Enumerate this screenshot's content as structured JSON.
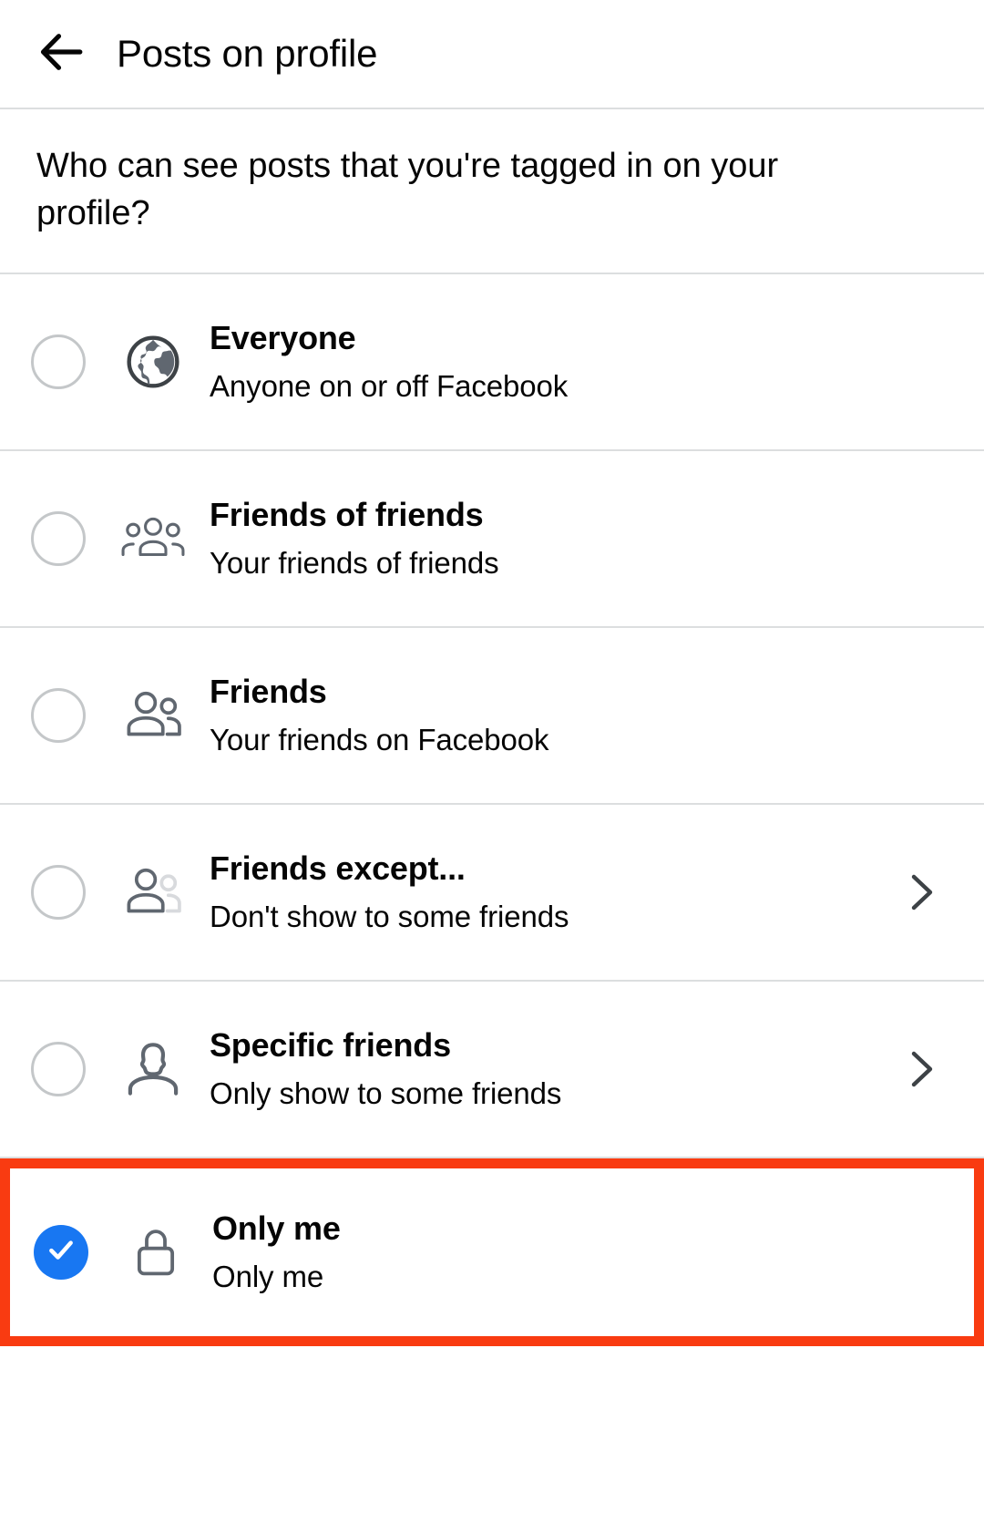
{
  "header": {
    "back_icon": "arrow-left-icon",
    "title": "Posts on profile"
  },
  "question": {
    "text": "Who can see posts that you're tagged in on your profile?"
  },
  "colors": {
    "accent_blue": "#1877f2",
    "highlight_red": "#f93b11",
    "divider": "#dcdedf",
    "text_primary": "#050505",
    "icon_gray": "#606770",
    "radio_outline": "#c4c7c9"
  },
  "options": [
    {
      "id": "everyone",
      "title": "Everyone",
      "subtitle": "Anyone on or off Facebook",
      "icon": "globe-icon",
      "selected": false,
      "has_chevron": false,
      "highlighted": false
    },
    {
      "id": "friends-of-friends",
      "title": "Friends of friends",
      "subtitle": "Your friends of friends",
      "icon": "three-people-icon",
      "selected": false,
      "has_chevron": false,
      "highlighted": false
    },
    {
      "id": "friends",
      "title": "Friends",
      "subtitle": "Your friends on Facebook",
      "icon": "two-people-icon",
      "selected": false,
      "has_chevron": false,
      "highlighted": false
    },
    {
      "id": "friends-except",
      "title": "Friends except...",
      "subtitle": "Don't show to some friends",
      "icon": "friends-except-icon",
      "selected": false,
      "has_chevron": true,
      "highlighted": false
    },
    {
      "id": "specific-friends",
      "title": "Specific friends",
      "subtitle": "Only show to some friends",
      "icon": "single-person-icon",
      "selected": false,
      "has_chevron": true,
      "highlighted": false
    },
    {
      "id": "only-me",
      "title": "Only me",
      "subtitle": "Only me",
      "icon": "lock-icon",
      "selected": true,
      "has_chevron": false,
      "highlighted": true
    }
  ]
}
